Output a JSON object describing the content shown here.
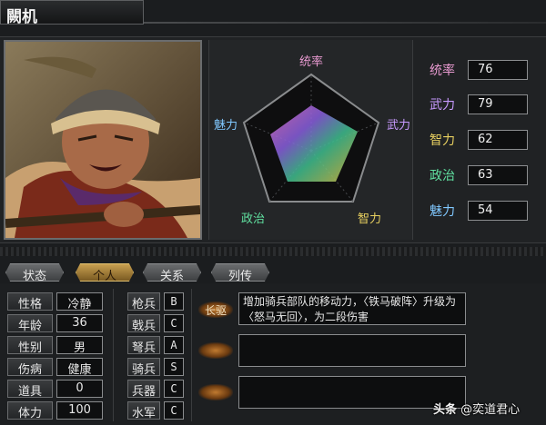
{
  "general": {
    "name": "闕机"
  },
  "radar": {
    "labels": {
      "tongshuai": "统率",
      "wuli": "武力",
      "zhili": "智力",
      "zhengzhi": "政治",
      "meili": "魅力"
    }
  },
  "stats": [
    {
      "label": "统率",
      "value": "76",
      "color": "#e89ad0"
    },
    {
      "label": "武力",
      "value": "79",
      "color": "#c89aff"
    },
    {
      "label": "智力",
      "value": "62",
      "color": "#e8d060"
    },
    {
      "label": "政治",
      "value": "63",
      "color": "#60e0a0"
    },
    {
      "label": "魅力",
      "value": "54",
      "color": "#80c8ff"
    }
  ],
  "tabs": [
    {
      "label": "状态",
      "active": false
    },
    {
      "label": "个人",
      "active": true
    },
    {
      "label": "关系",
      "active": false
    },
    {
      "label": "列传",
      "active": false
    }
  ],
  "personal": [
    {
      "label": "性格",
      "value": "冷静"
    },
    {
      "label": "年龄",
      "value": "36"
    },
    {
      "label": "性别",
      "value": "男"
    },
    {
      "label": "伤病",
      "value": "健康"
    },
    {
      "label": "道具",
      "value": "0"
    },
    {
      "label": "体力",
      "value": "100"
    }
  ],
  "aptitude": [
    {
      "label": "枪兵",
      "grade": "B"
    },
    {
      "label": "戟兵",
      "grade": "C"
    },
    {
      "label": "弩兵",
      "grade": "A"
    },
    {
      "label": "骑兵",
      "grade": "S"
    },
    {
      "label": "兵器",
      "grade": "C"
    },
    {
      "label": "水军",
      "grade": "C"
    }
  ],
  "skills": [
    {
      "name": "长驱",
      "desc": "增加骑兵部队的移动力，〈铁马破阵〉升级为〈怒马无回〉，为二段伤害"
    },
    {
      "name": "",
      "desc": ""
    },
    {
      "name": "",
      "desc": ""
    }
  ],
  "watermark": {
    "brand": "头条",
    "handle": "@奕道君心"
  }
}
